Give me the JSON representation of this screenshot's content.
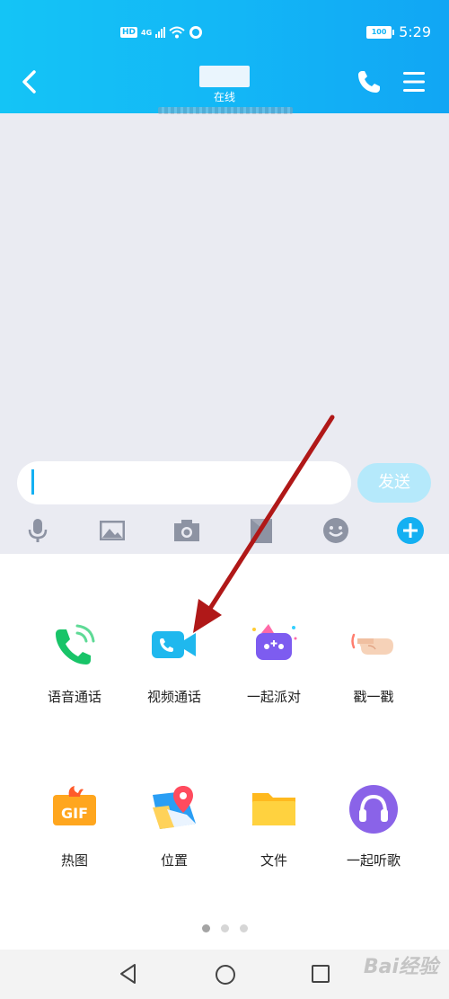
{
  "status_bar": {
    "network_badge": "HD",
    "signal_label": "4G",
    "battery": "100",
    "time": "5:29"
  },
  "header": {
    "title": "",
    "subtitle": "在线"
  },
  "composer": {
    "input_value": "",
    "send_label": "发送"
  },
  "toolbar": {
    "icons": [
      "microphone-icon",
      "image-icon",
      "camera-icon",
      "red-packet-icon",
      "emoji-icon",
      "plus-icon"
    ]
  },
  "features": {
    "voice_call": "语音通话",
    "video_call": "视频通话",
    "party": "一起派对",
    "poke": "戳一戳",
    "hot_gif": "热图",
    "location": "位置",
    "file": "文件",
    "listen_together": "一起听歌"
  },
  "pager": {
    "pages": 3,
    "active": 1
  },
  "watermark": "Bai经验",
  "colors": {
    "header": "#13b7f6",
    "chat_bg": "#eaebf2",
    "send_disabled": "#b5e9fb",
    "accent": "#14b0f2",
    "annotation_arrow": "#b01818"
  }
}
